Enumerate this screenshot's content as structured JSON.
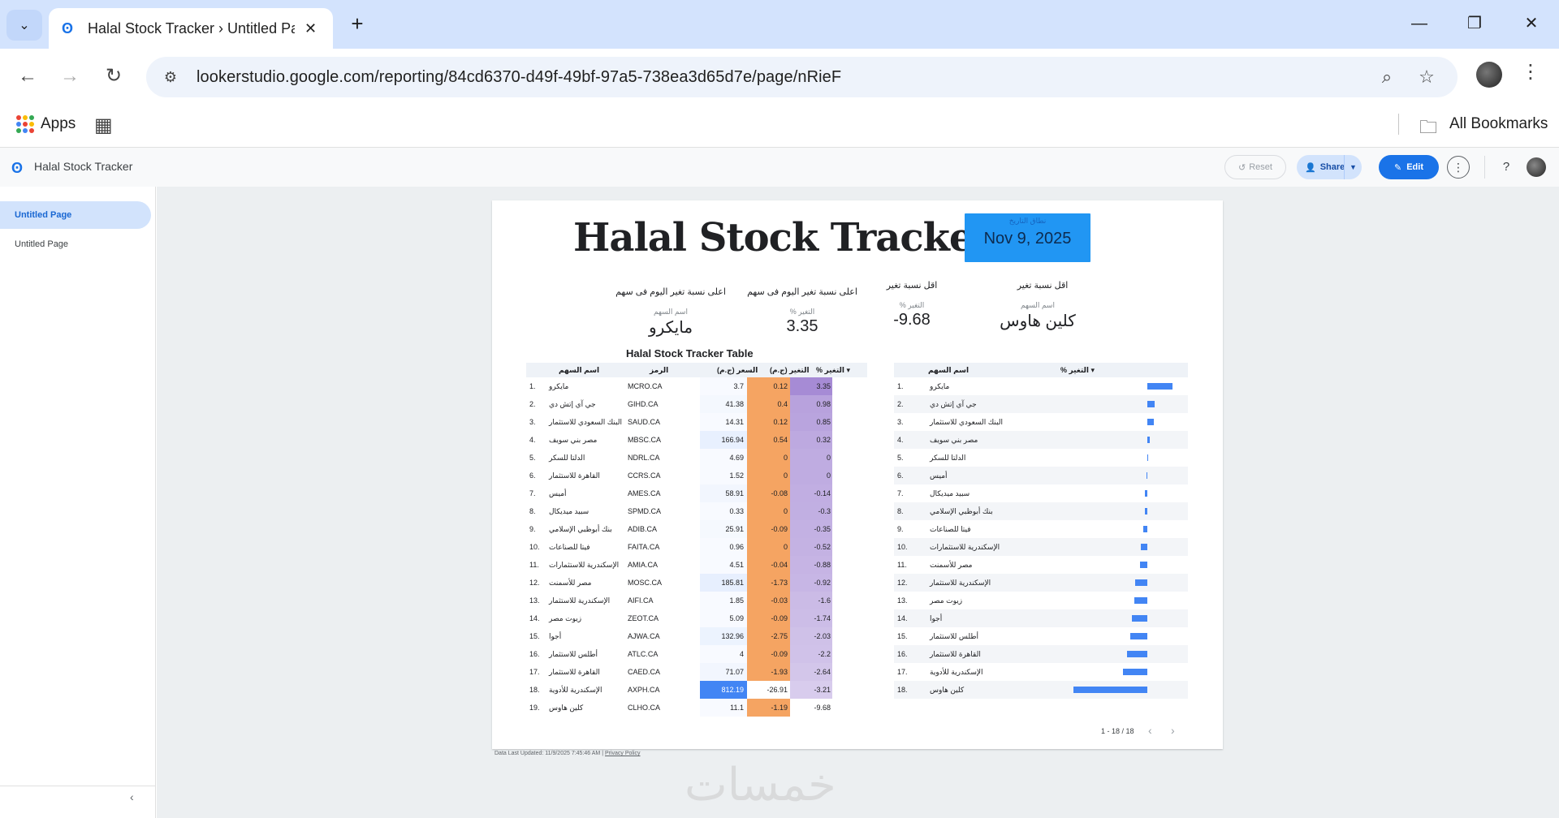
{
  "browser": {
    "tab_title": "Halal Stock Tracker › Untitled Pa",
    "url": "lookerstudio.google.com/reporting/84cd6370-d49f-49bf-97a5-738ea3d65d7e/page/nRieF",
    "bookmarks": {
      "apps": "Apps",
      "all": "All Bookmarks"
    }
  },
  "header": {
    "title": "Halal Stock Tracker",
    "reset": "Reset",
    "share": "Share",
    "edit": "Edit"
  },
  "sidebar": {
    "pages": [
      "Untitled Page",
      "Untitled Page"
    ]
  },
  "report": {
    "title": "Halal Stock Tracker",
    "date_label": "نطاق التاريخ",
    "date": "Nov 9, 2025",
    "kpis": [
      {
        "heading": "اعلى نسبة تغير اليوم فى سهم",
        "sub": "اسم السهم",
        "value": "مايكرو"
      },
      {
        "heading": "اعلى نسبة تغير اليوم فى سهم",
        "sub": "% التغير",
        "value": "3.35"
      },
      {
        "heading": "اقل نسبة تغير",
        "sub": "% التغير",
        "value": "-9.68"
      },
      {
        "heading": "اقل نسبة تغير",
        "sub": "اسم السهم",
        "value": "كلين هاوس"
      }
    ],
    "table_title": "Halal Stock Tracker Table",
    "table_headers": {
      "name": "اسم السهم",
      "symbol": "الرمز",
      "price": "السعر (ج.م)",
      "change": "التغير (ج.م)",
      "pct": "% التغير ▾"
    },
    "table_rows": [
      {
        "n": "1.",
        "name": "مايكرو",
        "sym": "MCRO.CA",
        "price": "3.7",
        "chg": "0.12",
        "pct": "3.35"
      },
      {
        "n": "2.",
        "name": "جي آي إتش دي",
        "sym": "GIHD.CA",
        "price": "41.38",
        "chg": "0.4",
        "pct": "0.98"
      },
      {
        "n": "3.",
        "name": "البنك السعودي للاستثمار",
        "sym": "SAUD.CA",
        "price": "14.31",
        "chg": "0.12",
        "pct": "0.85"
      },
      {
        "n": "4.",
        "name": "مصر بني سويف",
        "sym": "MBSC.CA",
        "price": "166.94",
        "chg": "0.54",
        "pct": "0.32"
      },
      {
        "n": "5.",
        "name": "الدلتا للسكر",
        "sym": "NDRL.CA",
        "price": "4.69",
        "chg": "0",
        "pct": "0"
      },
      {
        "n": "6.",
        "name": "القاهرة للاستثمار",
        "sym": "CCRS.CA",
        "price": "1.52",
        "chg": "0",
        "pct": "0"
      },
      {
        "n": "7.",
        "name": "أميس",
        "sym": "AMES.CA",
        "price": "58.91",
        "chg": "-0.08",
        "pct": "-0.14"
      },
      {
        "n": "8.",
        "name": "سبيد ميديكال",
        "sym": "SPMD.CA",
        "price": "0.33",
        "chg": "0",
        "pct": "-0.3"
      },
      {
        "n": "9.",
        "name": "بنك أبوظبي الإسلامي",
        "sym": "ADIB.CA",
        "price": "25.91",
        "chg": "-0.09",
        "pct": "-0.35"
      },
      {
        "n": "10.",
        "name": "فيتا للصناعات",
        "sym": "FAITA.CA",
        "price": "0.96",
        "chg": "0",
        "pct": "-0.52"
      },
      {
        "n": "11.",
        "name": "الإسكندرية للاستثمارات",
        "sym": "AMIA.CA",
        "price": "4.51",
        "chg": "-0.04",
        "pct": "-0.88"
      },
      {
        "n": "12.",
        "name": "مصر للأسمنت",
        "sym": "MOSC.CA",
        "price": "185.81",
        "chg": "-1.73",
        "pct": "-0.92"
      },
      {
        "n": "13.",
        "name": "الإسكندرية للاستثمار",
        "sym": "AIFI.CA",
        "price": "1.85",
        "chg": "-0.03",
        "pct": "-1.6"
      },
      {
        "n": "14.",
        "name": "زيوت مصر",
        "sym": "ZEOT.CA",
        "price": "5.09",
        "chg": "-0.09",
        "pct": "-1.74"
      },
      {
        "n": "15.",
        "name": "أجوا",
        "sym": "AJWA.CA",
        "price": "132.96",
        "chg": "-2.75",
        "pct": "-2.03"
      },
      {
        "n": "16.",
        "name": "أطلس للاستثمار",
        "sym": "ATLC.CA",
        "price": "4",
        "chg": "-0.09",
        "pct": "-2.2"
      },
      {
        "n": "17.",
        "name": "القاهرة للاستثمار",
        "sym": "CAED.CA",
        "price": "71.07",
        "chg": "-1.93",
        "pct": "-2.64"
      },
      {
        "n": "18.",
        "name": "الإسكندرية للأدوية",
        "sym": "AXPH.CA",
        "price": "812.19",
        "chg": "-26.91",
        "pct": "-3.21"
      },
      {
        "n": "19.",
        "name": "كلين هاوس",
        "sym": "CLHO.CA",
        "price": "11.1",
        "chg": "-1.19",
        "pct": "-9.68"
      }
    ],
    "bar_headers": {
      "name": "اسم السهم",
      "pct": "% التغير ▾"
    },
    "bar_rows": [
      {
        "n": "1.",
        "name": "مايكرو",
        "pct": 3.35
      },
      {
        "n": "2.",
        "name": "جي آي إتش دي",
        "pct": 0.98
      },
      {
        "n": "3.",
        "name": "البنك السعودي للاستثمار",
        "pct": 0.85
      },
      {
        "n": "4.",
        "name": "مصر بني سويف",
        "pct": 0.32
      },
      {
        "n": "5.",
        "name": "الدلتا للسكر",
        "pct": 0.05
      },
      {
        "n": "6.",
        "name": "أميس",
        "pct": -0.14
      },
      {
        "n": "7.",
        "name": "سبيد ميديكال",
        "pct": -0.3
      },
      {
        "n": "8.",
        "name": "بنك أبوظبي الإسلامي",
        "pct": -0.35
      },
      {
        "n": "9.",
        "name": "فيتا للصناعات",
        "pct": -0.52
      },
      {
        "n": "10.",
        "name": "الإسكندرية للاستثمارات",
        "pct": -0.88
      },
      {
        "n": "11.",
        "name": "مصر للأسمنت",
        "pct": -0.92
      },
      {
        "n": "12.",
        "name": "الإسكندرية للاستثمار",
        "pct": -1.6
      },
      {
        "n": "13.",
        "name": "زيوت مصر",
        "pct": -1.74
      },
      {
        "n": "14.",
        "name": "أجوا",
        "pct": -2.03
      },
      {
        "n": "15.",
        "name": "أطلس للاستثمار",
        "pct": -2.2
      },
      {
        "n": "16.",
        "name": "القاهرة للاستثمار",
        "pct": -2.64
      },
      {
        "n": "17.",
        "name": "الإسكندرية للأدوية",
        "pct": -3.21
      },
      {
        "n": "18.",
        "name": "كلين هاوس",
        "pct": -9.68
      }
    ],
    "pager": "1 - 18 / 18",
    "footer": "Data Last Updated: 11/9/2025 7:45:46 AM",
    "privacy": "Privacy Policy"
  },
  "watermark": "خمسات",
  "colors": {
    "accent": "#1a73e8",
    "bar": "#4285f4",
    "date_box": "#2196f3",
    "change_col": "#f5a462",
    "pct_col": "#b39ddb",
    "price_hi": "#4285f4"
  }
}
